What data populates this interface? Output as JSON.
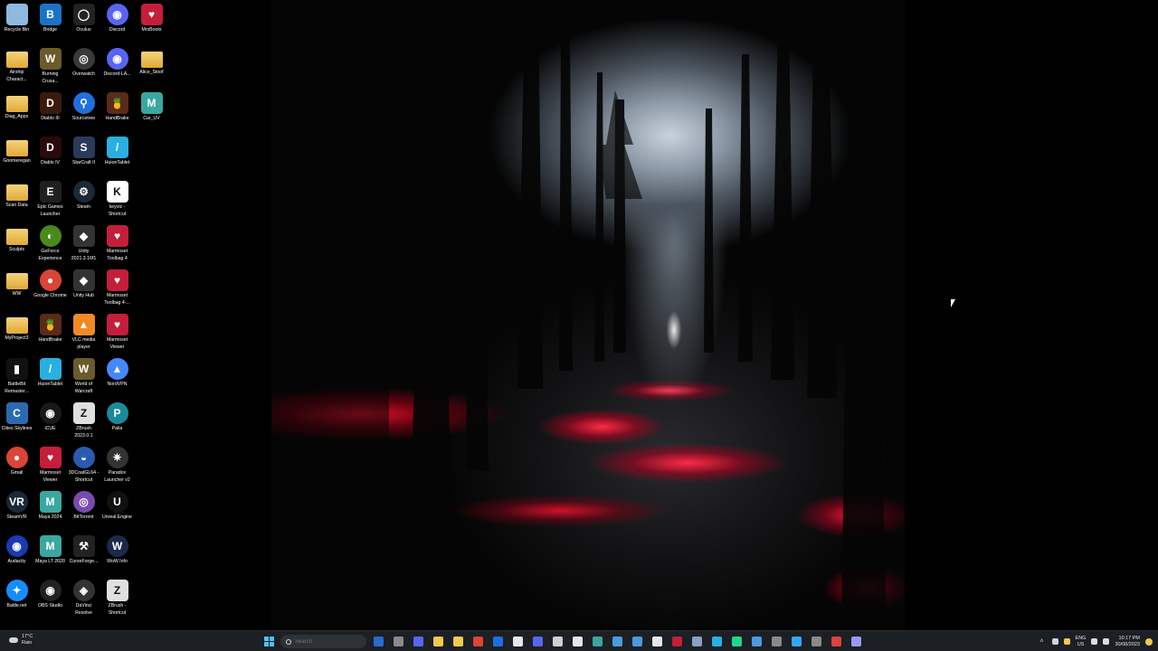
{
  "desktop": {
    "icons": [
      {
        "label": "Recycle Bin",
        "icon": "recycle-bin-icon",
        "color": "#8fb9e0",
        "glyph": ""
      },
      {
        "label": "Bridge",
        "icon": "bridge-icon",
        "color": "#1a73c8",
        "glyph": "B"
      },
      {
        "label": "Oculus",
        "icon": "oculus-icon",
        "color": "#222222",
        "glyph": "◯"
      },
      {
        "label": "Discord",
        "icon": "discord-icon",
        "color": "#5865f2",
        "glyph": "◉"
      },
      {
        "label": "MrsBoots",
        "icon": "marmoset-icon",
        "color": "#c41e3a",
        "glyph": "♥"
      },
      {
        "label": "Airship Charact...",
        "icon": "folder-icon",
        "color": "#e8b84a",
        "glyph": ""
      },
      {
        "label": "Burning Crusa...",
        "icon": "world-of-warcraft-icon",
        "color": "#6b5a2a",
        "glyph": "W"
      },
      {
        "label": "Overwatch",
        "icon": "overwatch-icon",
        "color": "#3a3a3a",
        "glyph": "◎"
      },
      {
        "label": "Discord-LA...",
        "icon": "discord-icon",
        "color": "#5865f2",
        "glyph": "◉"
      },
      {
        "label": "Alice_Stoof",
        "icon": "folder-icon",
        "color": "#e8b84a",
        "glyph": ""
      },
      {
        "label": "Diag_Apps",
        "icon": "folder-icon",
        "color": "#e8b84a",
        "glyph": ""
      },
      {
        "label": "Diablo III",
        "icon": "diablo-icon",
        "color": "#3a1a0a",
        "glyph": "D"
      },
      {
        "label": "Sourcetree",
        "icon": "sourcetree-icon",
        "color": "#1f6fdf",
        "glyph": "⚲"
      },
      {
        "label": "HandBrake",
        "icon": "handbrake-icon",
        "color": "#5a2a1a",
        "glyph": "🍍"
      },
      {
        "label": "Car_UV",
        "icon": "maya-icon",
        "color": "#3aa7a0",
        "glyph": "M"
      },
      {
        "label": "Gnomeregan",
        "icon": "folder-icon",
        "color": "#e8b84a",
        "glyph": ""
      },
      {
        "label": "Diablo IV",
        "icon": "diablo-icon",
        "color": "#2a0a0a",
        "glyph": "D"
      },
      {
        "label": "StarCraft II",
        "icon": "starcraft-icon",
        "color": "#2a3a5a",
        "glyph": "S"
      },
      {
        "label": "HuionTablet",
        "icon": "huion-icon",
        "color": "#2ab0e0",
        "glyph": "/"
      },
      {
        "label": "Scan Data",
        "icon": "folder-icon",
        "color": "#e8b84a",
        "glyph": ""
      },
      {
        "label": "Epic Games Launcher",
        "icon": "epic-games-icon",
        "color": "#202020",
        "glyph": "E"
      },
      {
        "label": "Steam",
        "icon": "steam-icon",
        "color": "#1b2838",
        "glyph": "⚙"
      },
      {
        "label": "keyviz - Shortcut",
        "icon": "keyviz-icon",
        "color": "#ffffff",
        "glyph": "K"
      },
      {
        "label": "Sculpts",
        "icon": "folder-icon",
        "color": "#e8b84a",
        "glyph": ""
      },
      {
        "label": "GeForce Experience",
        "icon": "nvidia-icon",
        "color": "#4a8a1a",
        "glyph": "◐"
      },
      {
        "label": "Unity 2021.3.16f1",
        "icon": "unity-icon",
        "color": "#333333",
        "glyph": "◆"
      },
      {
        "label": "Marmoset Toolbag 4",
        "icon": "marmoset-icon",
        "color": "#c41e3a",
        "glyph": "♥"
      },
      {
        "label": "WW",
        "icon": "folder-icon",
        "color": "#e8b84a",
        "glyph": ""
      },
      {
        "label": "Google Chrome",
        "icon": "chrome-icon",
        "color": "#db4437",
        "glyph": "●"
      },
      {
        "label": "Unity Hub",
        "icon": "unity-icon",
        "color": "#333333",
        "glyph": "◆"
      },
      {
        "label": "Marmoset Toolbag 4-...",
        "icon": "marmoset-icon",
        "color": "#c41e3a",
        "glyph": "♥"
      },
      {
        "label": "MyProject3",
        "icon": "folder-icon",
        "color": "#e8b84a",
        "glyph": ""
      },
      {
        "label": "HandBrake",
        "icon": "handbrake-icon",
        "color": "#5a2a1a",
        "glyph": "🍍"
      },
      {
        "label": "VLC media player",
        "icon": "vlc-icon",
        "color": "#f08a24",
        "glyph": "▲"
      },
      {
        "label": "Marmoset Viewer",
        "icon": "marmoset-icon",
        "color": "#c41e3a",
        "glyph": "♥"
      },
      {
        "label": "BattleBit Remaster...",
        "icon": "battlebit-icon",
        "color": "#111111",
        "glyph": "▮"
      },
      {
        "label": "HuionTablet",
        "icon": "huion-icon",
        "color": "#2ab0e0",
        "glyph": "/"
      },
      {
        "label": "World of Warcraft",
        "icon": "world-of-warcraft-icon",
        "color": "#6b5a2a",
        "glyph": "W"
      },
      {
        "label": "NordVPN",
        "icon": "nordvpn-icon",
        "color": "#4687ff",
        "glyph": "▲"
      },
      {
        "label": "Cities Skylines",
        "icon": "cities-skylines-icon",
        "color": "#2a6ab0",
        "glyph": "C"
      },
      {
        "label": "iCUE",
        "icon": "icue-icon",
        "color": "#1a1a1a",
        "glyph": "◉"
      },
      {
        "label": "ZBrush 2023.0.1",
        "icon": "zbrush-icon",
        "color": "#e0e0e0",
        "glyph": "Z"
      },
      {
        "label": "Palia",
        "icon": "palia-icon",
        "color": "#1a8a9a",
        "glyph": "P"
      },
      {
        "label": "Gmail",
        "icon": "chrome-icon",
        "color": "#db4437",
        "glyph": "●"
      },
      {
        "label": "Marmoset Viewer",
        "icon": "marmoset-icon",
        "color": "#c41e3a",
        "glyph": "♥"
      },
      {
        "label": "3DCoatGL64 - Shortcut",
        "icon": "3dcoat-icon",
        "color": "#2a5ab0",
        "glyph": "◒"
      },
      {
        "label": "Paradox Launcher v2",
        "icon": "paradox-icon",
        "color": "#333333",
        "glyph": "✷"
      },
      {
        "label": "SteamVR",
        "icon": "steamvr-icon",
        "color": "#1b2838",
        "glyph": "VR"
      },
      {
        "label": "Maya 2024",
        "icon": "maya-icon",
        "color": "#3aa7a0",
        "glyph": "M"
      },
      {
        "label": "BitTorrent",
        "icon": "bittorrent-icon",
        "color": "#7a4ab0",
        "glyph": "◎"
      },
      {
        "label": "Unreal Engine",
        "icon": "unreal-engine-icon",
        "color": "#111111",
        "glyph": "U"
      },
      {
        "label": "Audacity",
        "icon": "audacity-icon",
        "color": "#1a3ab0",
        "glyph": "◉"
      },
      {
        "label": "Maya LT 2020",
        "icon": "maya-icon",
        "color": "#3aa7a0",
        "glyph": "M"
      },
      {
        "label": "CurseForge...",
        "icon": "curseforge-icon",
        "color": "#222222",
        "glyph": "⚒"
      },
      {
        "label": "WoW Info",
        "icon": "wow-info-icon",
        "color": "#1a2a4a",
        "glyph": "W"
      },
      {
        "label": "Battle.net",
        "icon": "battle-net-icon",
        "color": "#148eff",
        "glyph": "✦"
      },
      {
        "label": "OBS Studio",
        "icon": "obs-icon",
        "color": "#222222",
        "glyph": "◉"
      },
      {
        "label": "DaVinci Resolve",
        "icon": "davinci-resolve-icon",
        "color": "#333333",
        "glyph": "◈"
      },
      {
        "label": "ZBrush - Shortcut",
        "icon": "zbrush-icon",
        "color": "#e0e0e0",
        "glyph": "Z"
      }
    ]
  },
  "taskbar": {
    "weather": {
      "temp": "17°C",
      "condition": "Rain",
      "icon": "cloud-rain-icon"
    },
    "search_placeholder": "Search",
    "apps": [
      {
        "icon": "widgets-icon",
        "color": "#2a6ad0"
      },
      {
        "icon": "task-view-icon",
        "color": "#8a8a8a"
      },
      {
        "icon": "chat-icon",
        "color": "#5865f2"
      },
      {
        "icon": "file-explorer-icon",
        "color": "#f2c94c"
      },
      {
        "icon": "microsoft-store-icon",
        "color": "#f2c94c"
      },
      {
        "icon": "chrome-icon",
        "color": "#db4437"
      },
      {
        "icon": "sourcetree-icon",
        "color": "#1f6fdf"
      },
      {
        "icon": "notion-icon",
        "color": "#e6e6e6"
      },
      {
        "icon": "discord-icon",
        "color": "#5865f2"
      },
      {
        "icon": "unity-icon",
        "color": "#d0d0d0"
      },
      {
        "icon": "notepad-icon",
        "color": "#e6e6e6"
      },
      {
        "icon": "maya-icon",
        "color": "#3aa7a0"
      },
      {
        "icon": "calendar-icon",
        "color": "#4a9ae0"
      },
      {
        "icon": "photos-icon",
        "color": "#4a9ae0"
      },
      {
        "icon": "document-icon",
        "color": "#e6e6e6"
      },
      {
        "icon": "marmoset-icon",
        "color": "#c41e3a"
      },
      {
        "icon": "calculator-icon",
        "color": "#8aa0c0"
      },
      {
        "icon": "huion-icon",
        "color": "#2ab0e0"
      },
      {
        "icon": "pycharm-icon",
        "color": "#21d789"
      },
      {
        "icon": "notes-icon",
        "color": "#4a9ae0"
      },
      {
        "icon": "snipping-tool-icon",
        "color": "#8a8a8a"
      },
      {
        "icon": "photoshop-icon",
        "color": "#31a8ff"
      },
      {
        "icon": "capture-icon",
        "color": "#8a8a8a"
      },
      {
        "icon": "chrome-alt-icon",
        "color": "#db4437"
      },
      {
        "icon": "after-effects-icon",
        "color": "#9999ff"
      }
    ],
    "tray": {
      "lang": "ENG",
      "region": "US",
      "time": "10:17 PM",
      "date": "30/08/2023"
    }
  }
}
